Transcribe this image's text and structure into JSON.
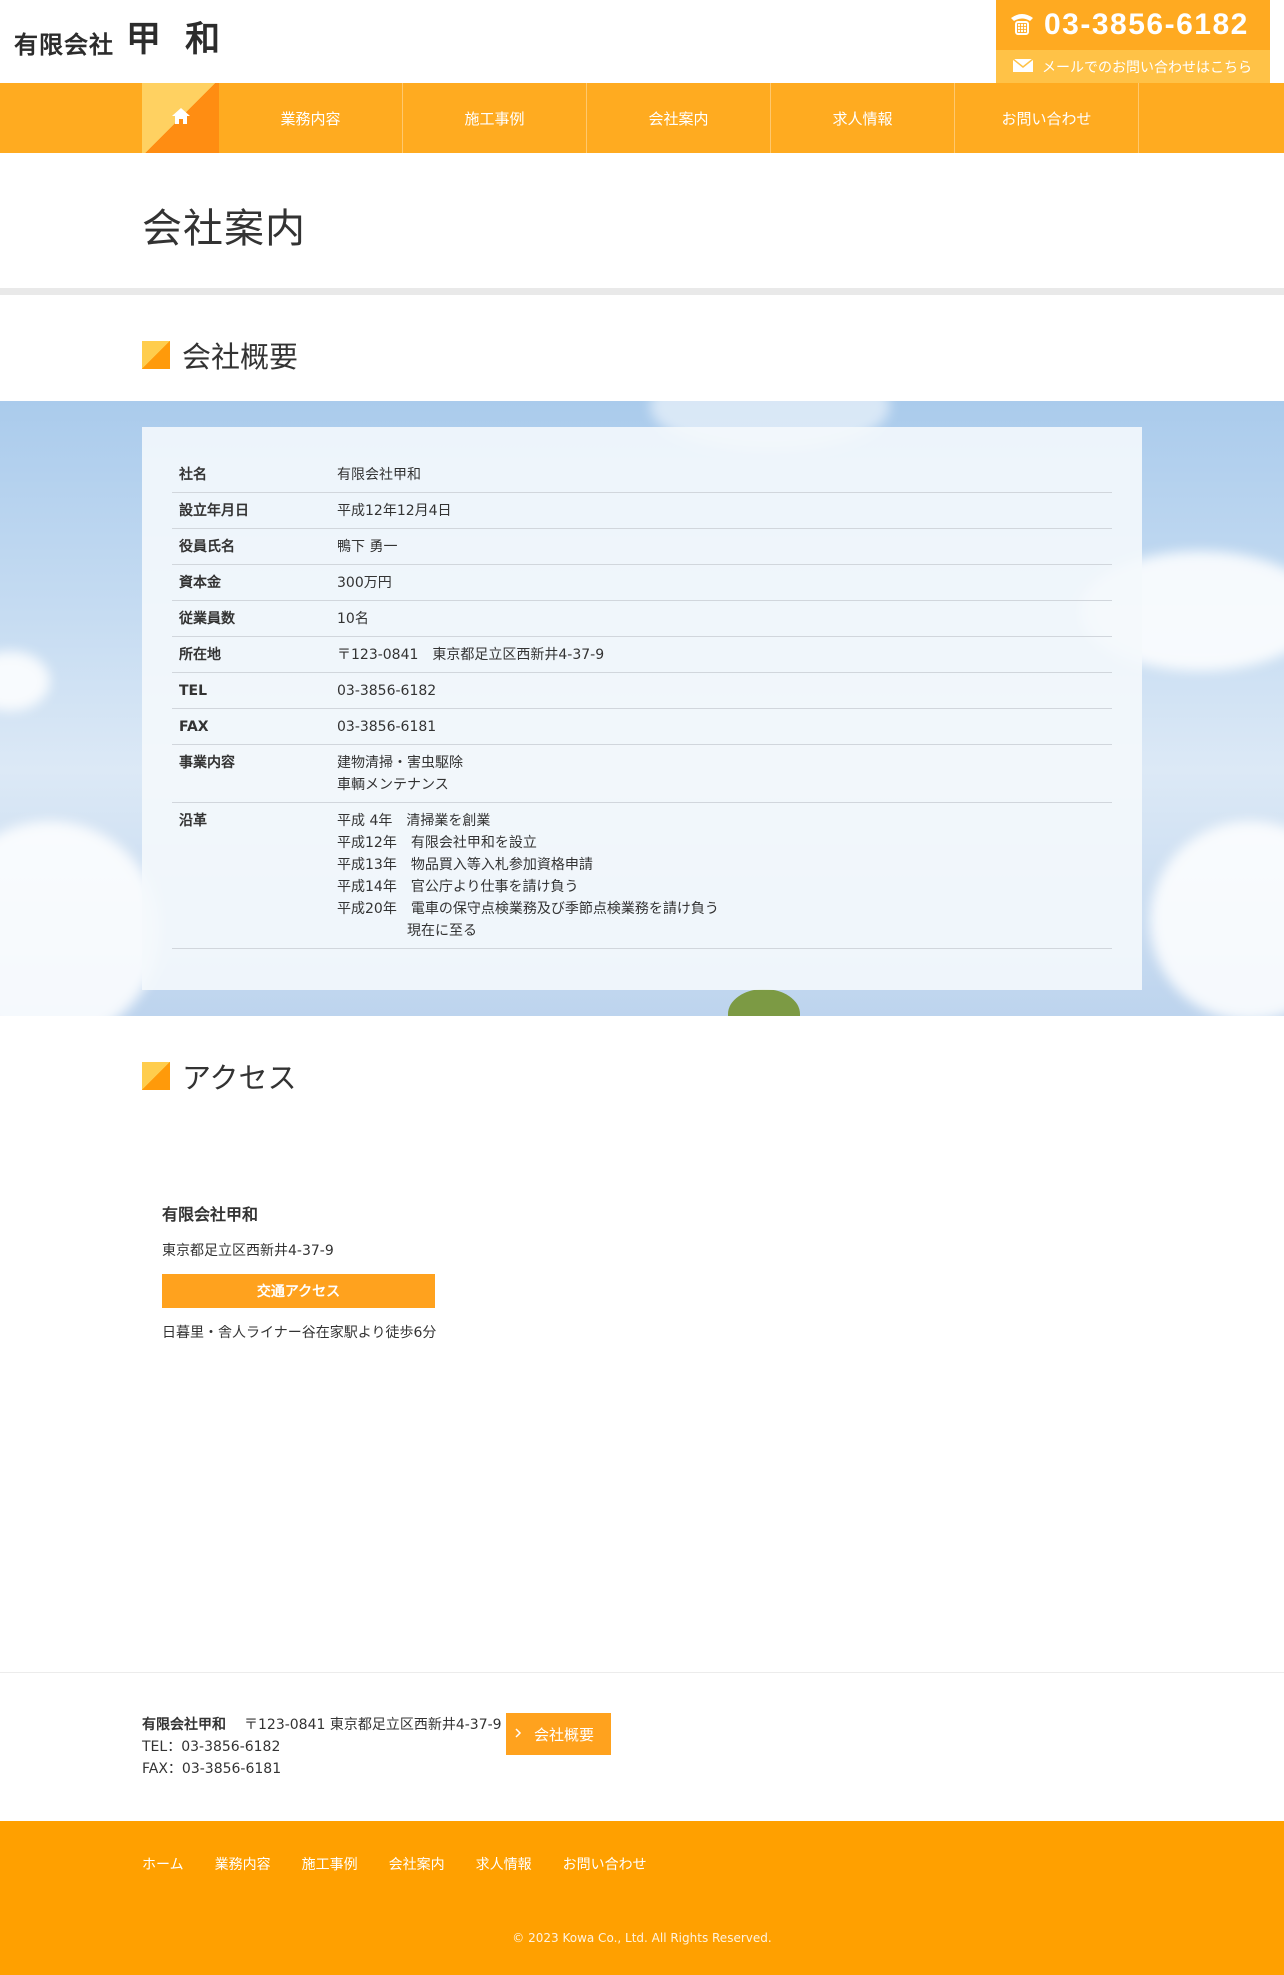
{
  "header": {
    "logo_prefix": "有限会社",
    "logo_name": "甲 和",
    "phone": "03-3856-6182",
    "mail_text": "メールでのお問い合わせはこちら"
  },
  "nav": {
    "home_icon": "home-icon",
    "items": [
      "業務内容",
      "施工事例",
      "会社案内",
      "求人情報",
      "お問い合わせ"
    ]
  },
  "page_title": "会社案内",
  "overview": {
    "heading": "会社概要",
    "rows": [
      {
        "label": "社名",
        "lines": [
          "有限会社甲和"
        ]
      },
      {
        "label": "設立年月日",
        "lines": [
          "平成12年12月4日"
        ]
      },
      {
        "label": "役員氏名",
        "lines": [
          "鴨下 勇一"
        ]
      },
      {
        "label": "資本金",
        "lines": [
          "300万円"
        ]
      },
      {
        "label": "従業員数",
        "lines": [
          "10名"
        ]
      },
      {
        "label": "所在地",
        "lines": [
          "〒123-0841　東京都足立区西新井4-37-9"
        ]
      },
      {
        "label": "TEL",
        "lines": [
          "03-3856-6182"
        ]
      },
      {
        "label": "FAX",
        "lines": [
          "03-3856-6181"
        ]
      },
      {
        "label": "事業内容",
        "lines": [
          "建物清掃・害虫駆除",
          "車輌メンテナンス"
        ]
      },
      {
        "label": "沿革",
        "lines": [
          "平成 4年　清掃業を創業",
          "平成12年　有限会社甲和を設立",
          "平成13年　物品買入等入札参加資格申請",
          "平成14年　官公庁より仕事を請け負う",
          "平成20年　電車の保守点検業務及び季節点検業務を請け負う",
          "　　　　　現在に至る"
        ]
      }
    ]
  },
  "access": {
    "heading": "アクセス",
    "company": "有限会社甲和",
    "address": "東京都足立区西新井4-37-9",
    "button": "交通アクセス",
    "route": "日暮里・舎人ライナー谷在家駅より徒歩6分"
  },
  "footer_info": {
    "company": "有限会社甲和",
    "address": "〒123-0841 東京都足立区西新井4-37-9",
    "tel": "TEL：03-3856-6182",
    "fax": "FAX：03-3856-6181",
    "button": "会社概要"
  },
  "footer": {
    "links": [
      "ホーム",
      "業務内容",
      "施工事例",
      "会社案内",
      "求人情報",
      "お問い合わせ"
    ],
    "copyright": "© 2023 Kowa Co., Ltd. All Rights Reserved."
  },
  "colors": {
    "accent": "#ffab20",
    "accent_dark": "#ffa000",
    "text": "#333333"
  }
}
